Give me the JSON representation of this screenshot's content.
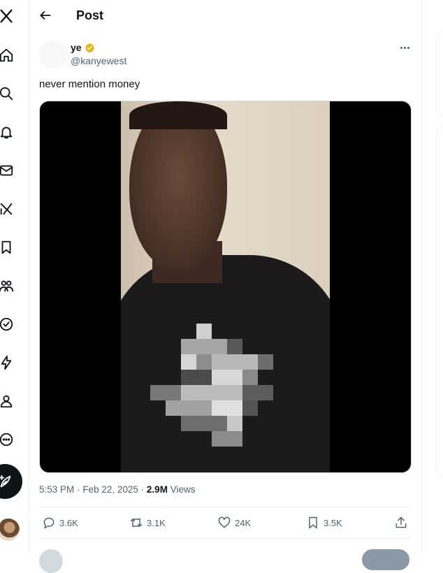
{
  "header": {
    "title": "Post"
  },
  "post": {
    "author_name": "ye",
    "author_handle": "@kanyewest",
    "text": "never mention money",
    "time": "5:53 PM",
    "date": "Feb 22, 2025",
    "views_count": "2.9M",
    "views_label": "Views",
    "sep": "·"
  },
  "actions": {
    "replies": "3.6K",
    "reposts": "3.1K",
    "likes": "24K",
    "bookmarks": "3.5K"
  },
  "nav_icons": [
    "x-logo-icon",
    "home-icon",
    "search-icon",
    "notifications-icon",
    "messages-icon",
    "grok-icon",
    "bookmarks-icon",
    "communities-icon",
    "verified-icon",
    "lightning-icon",
    "profile-icon",
    "more-circle-icon"
  ],
  "colors": {
    "text": "#0f1419",
    "secondary": "#536471",
    "verified_gold": "#e2b719",
    "border": "#eff3f4"
  }
}
